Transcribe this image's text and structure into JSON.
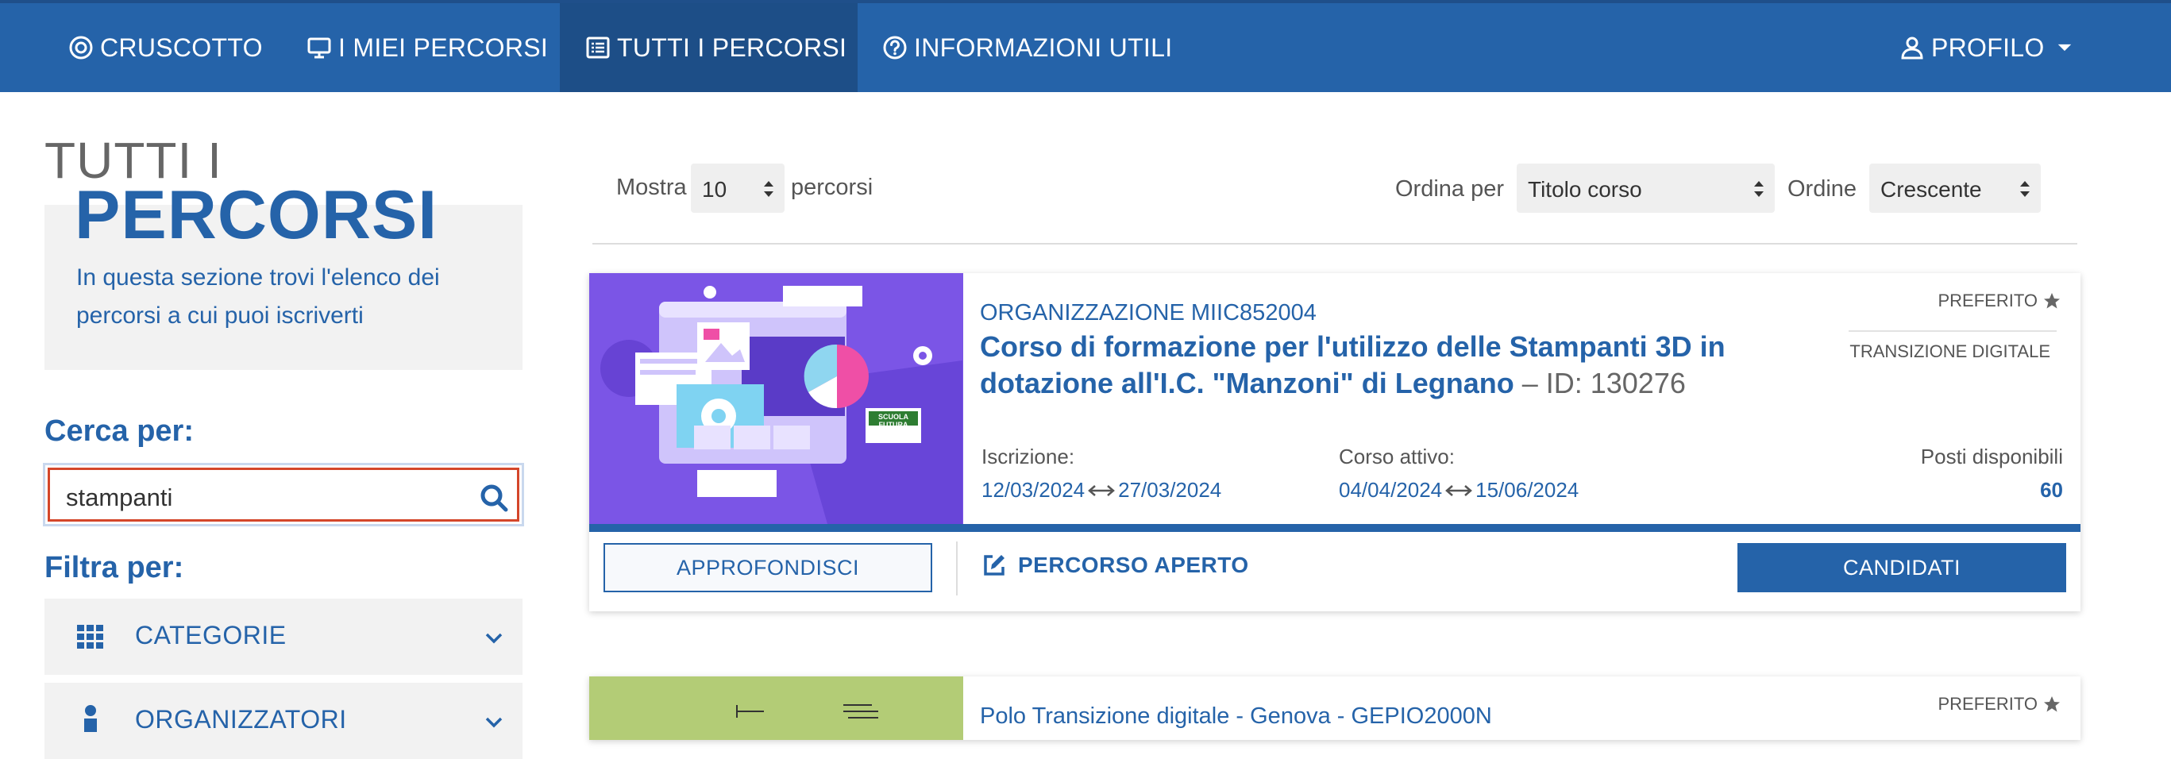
{
  "nav": {
    "items": [
      {
        "label": "CRUSCOTTO",
        "icon": "target-icon"
      },
      {
        "label": "I MIEI PERCORSI",
        "icon": "monitor-icon"
      },
      {
        "label": "TUTTI I PERCORSI",
        "icon": "list-icon",
        "active": true
      },
      {
        "label": "INFORMAZIONI UTILI",
        "icon": "question-icon"
      }
    ],
    "profile_label": "PROFILO"
  },
  "sidebar": {
    "title_line1": "TUTTI I",
    "title_line2": "PERCORSI",
    "description": "In questa sezione trovi l'elenco dei percorsi a cui puoi iscriverti",
    "search_label": "Cerca per:",
    "search_value": "stampanti",
    "filter_label": "Filtra per:",
    "filters": [
      {
        "label": "CATEGORIE"
      },
      {
        "label": "ORGANIZZATORI"
      }
    ]
  },
  "toolbar": {
    "show_label": "Mostra",
    "show_value": "10",
    "show_suffix": "percorsi",
    "sort_label": "Ordina per",
    "sort_value": "Titolo corso",
    "order_label": "Ordine",
    "order_value": "Crescente"
  },
  "courses": [
    {
      "organization": "ORGANIZZAZIONE MIIC852004",
      "title": "Corso di formazione per l'utilizzo delle Stampanti 3D in dotazione all'I.C. \"Manzoni\" di Legnano",
      "id_text": " – ID: 130276",
      "favorite_label": "PREFERITO",
      "category": "TRANSIZIONE DIGITALE",
      "enroll_label": "Iscrizione:",
      "enroll_start": "12/03/2024",
      "enroll_end": "27/03/2024",
      "active_label": "Corso attivo:",
      "active_start": "04/04/2024",
      "active_end": "15/06/2024",
      "seats_label": "Posti disponibili",
      "seats_value": "60",
      "details_button": "APPROFONDISCI",
      "status_label": "PERCORSO APERTO",
      "apply_button": "CANDIDATI",
      "image_badge": "SCUOLA FUTURA"
    },
    {
      "organization": "Polo Transizione digitale - Genova - GEPIO2000N",
      "favorite_label": "PREFERITO"
    }
  ],
  "colors": {
    "brand_blue": "#2563a9",
    "nav_active": "#1d4e87",
    "search_border": "#d4462a"
  }
}
